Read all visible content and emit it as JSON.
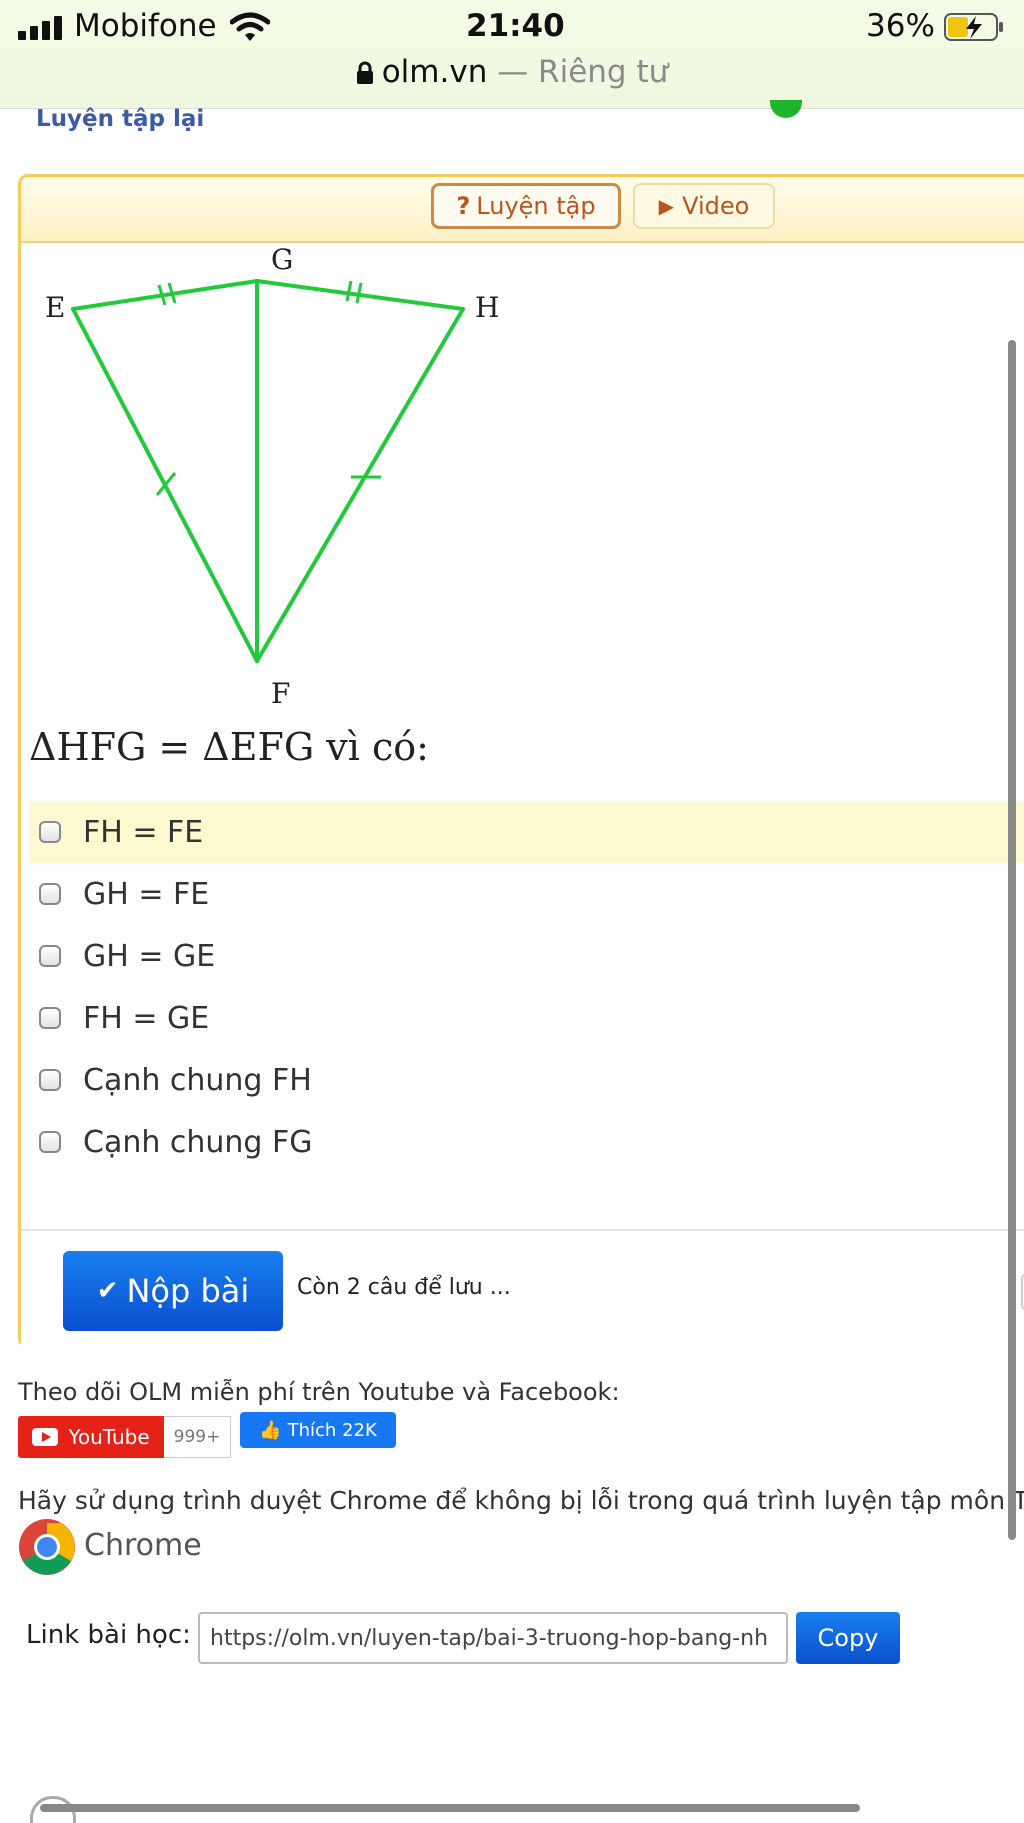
{
  "status_bar": {
    "carrier": "Mobifone",
    "time": "21:40",
    "battery_percent": "36%",
    "battery_level": 0.36,
    "url": "olm.vn",
    "privacy": "— Riêng tư"
  },
  "page": {
    "practice_again": "Luyện tập lại"
  },
  "tabs": {
    "practice_label": "Luyện tập",
    "video_label": "Video"
  },
  "figure": {
    "points": {
      "E": "E",
      "G": "G",
      "H": "H",
      "F": "F"
    },
    "line_color": "#22c93a"
  },
  "question": {
    "text": "ΔHFG = ΔEFG vì có:",
    "options": [
      {
        "label": "FH = FE"
      },
      {
        "label": "GH = FE"
      },
      {
        "label": "GH = GE"
      },
      {
        "label": "FH = GE"
      },
      {
        "label": "Cạnh chung FH"
      },
      {
        "label": "Cạnh chung FG"
      }
    ]
  },
  "submit": {
    "label": "Nộp bài",
    "remaining_text": "Còn 2 câu để lưu ..."
  },
  "follow": {
    "text": "Theo dõi OLM miễn phí trên Youtube và Facebook:",
    "youtube_label": "YouTube",
    "youtube_count": "999+",
    "facebook_label": "Thích",
    "facebook_count": "22K"
  },
  "browser_note": {
    "text": "Hãy sử dụng trình duyệt Chrome để không bị lỗi trong quá trình luyện tập môn Toá",
    "chrome_label": "Chrome"
  },
  "lesson_link": {
    "label": "Link bài học:",
    "value": "https://olm.vn/luyen-tap/bai-3-truong-hop-bang-nh",
    "copy_label": "Copy"
  },
  "colors": {
    "accent_blue": "#0a5fe0",
    "panel_border": "#f5cc5a",
    "highlight": "#fdf8cf"
  }
}
